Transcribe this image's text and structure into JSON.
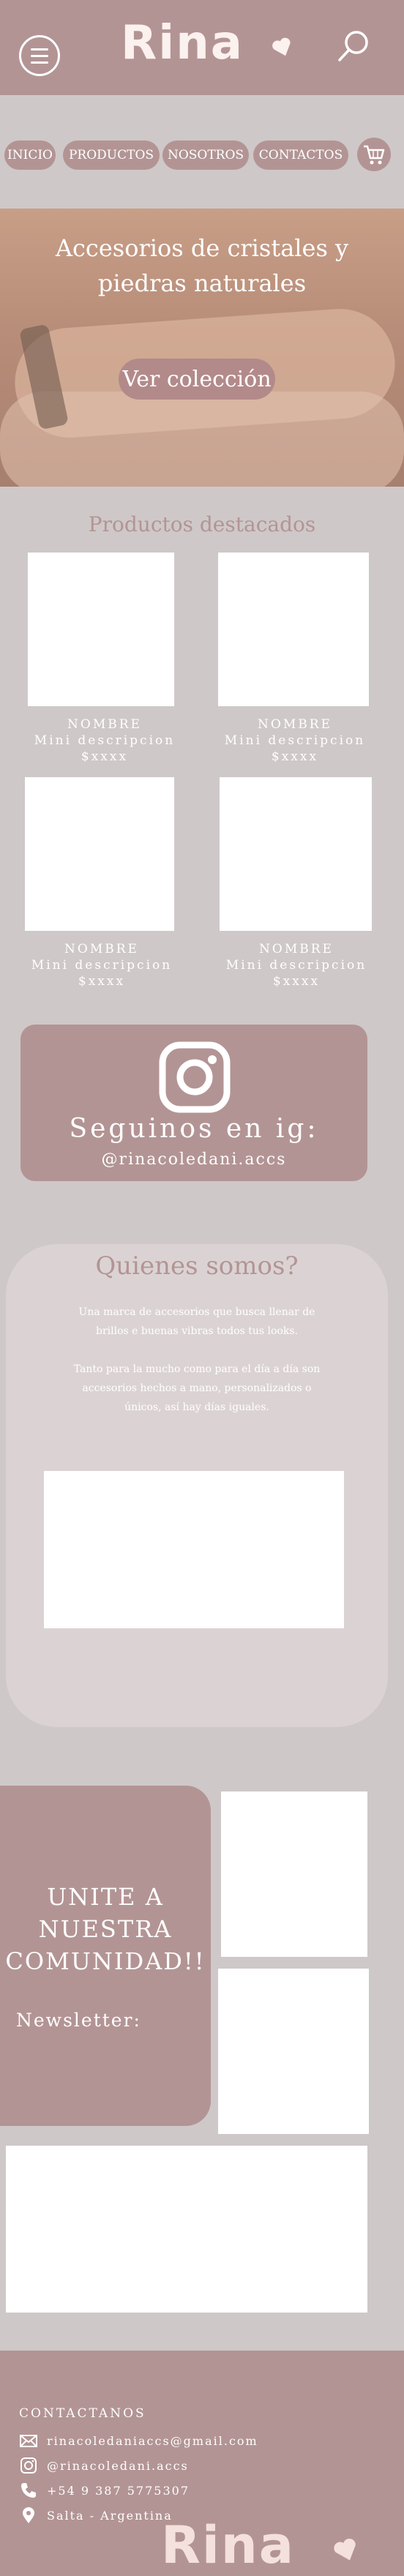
{
  "header": {
    "logo": "Rina",
    "menu_icon": "hamburger-menu-icon",
    "search_icon": "search-icon"
  },
  "nav": {
    "items": [
      {
        "label": "INICIO"
      },
      {
        "label": "PRODUCTOS"
      },
      {
        "label": "NOSOTROS"
      },
      {
        "label": "CONTACTOS"
      }
    ],
    "cart_icon": "cart-icon"
  },
  "hero": {
    "title": "Accesorios de cristales y piedras naturales",
    "cta_label": "Ver colección"
  },
  "featured": {
    "title": "Productos destacados",
    "products": [
      {
        "name": "NOMBRE",
        "desc": "Mini descripcion",
        "price": "$xxxx"
      },
      {
        "name": "NOMBRE",
        "desc": "Mini descripcion",
        "price": "$xxxx"
      },
      {
        "name": "NOMBRE",
        "desc": "Mini descripcion",
        "price": "$xxxx"
      },
      {
        "name": "NOMBRE",
        "desc": "Mini descripcion",
        "price": "$xxxx"
      }
    ]
  },
  "instagram": {
    "title": "Seguinos en ig:",
    "handle": "@rinacoledani.accs",
    "icon": "instagram-icon"
  },
  "about": {
    "title": "Quienes somos?",
    "paragraph1": "Una marca de accesorios que busca llenar de brillos e buenas vibras todos tus looks.",
    "paragraph2": "Tanto para la mucho como para el día a día son accesorios hechos a mano, personalizados o únicos, así hay días iguales."
  },
  "community": {
    "title": "UNITE A NUESTRA COMUNIDAD!!",
    "newsletter_label": "Newsletter:"
  },
  "footer": {
    "title": "CONTACTANOS",
    "email": "rinacoledaniaccs@gmail.com",
    "instagram": "@rinacoledani.accs",
    "phone": "+54 9 387 5775307",
    "location": "Salta - Argentina",
    "logo": "Rina"
  },
  "colors": {
    "accent": "#b39494",
    "page_bg": "#cfc8c8",
    "text_light": "#ffffff"
  }
}
